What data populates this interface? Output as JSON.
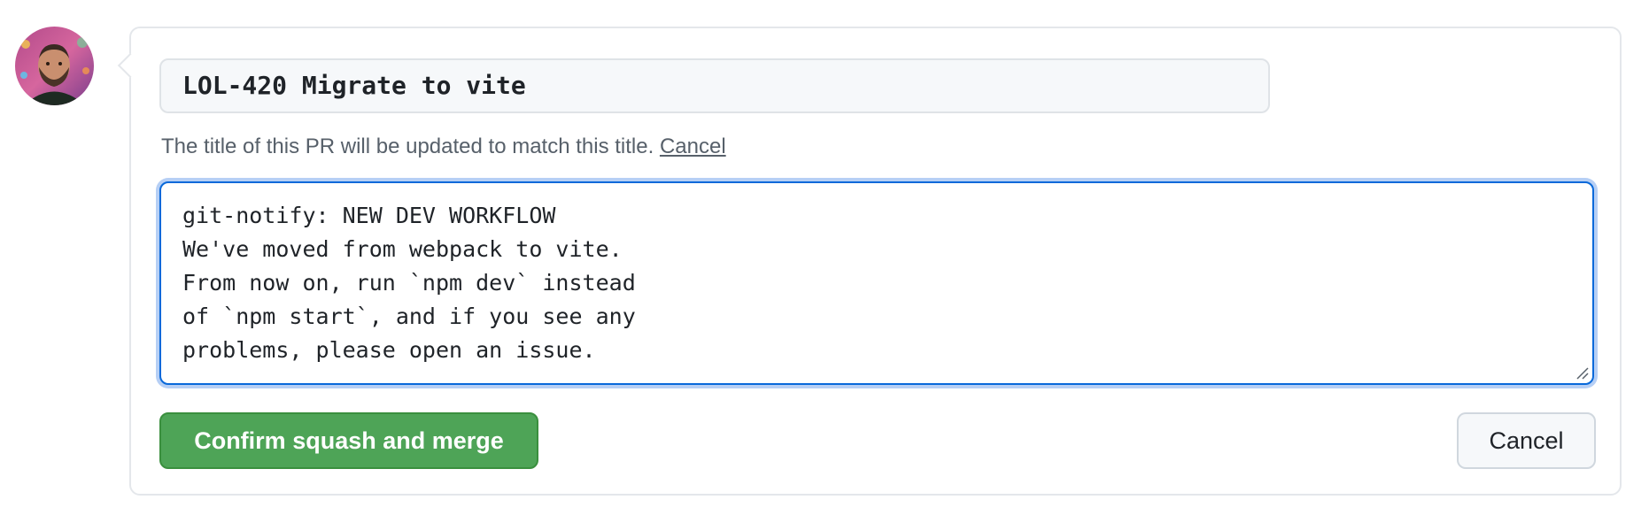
{
  "avatar": {
    "alt": "user avatar"
  },
  "title_field": {
    "value": "LOL-420 Migrate to vite"
  },
  "hint": {
    "text": "The title of this PR will be updated to match this title.",
    "cancel_link": "Cancel"
  },
  "message": {
    "value": "git-notify: NEW DEV WORKFLOW\nWe've moved from webpack to vite.\nFrom now on, run `npm dev` instead\nof `npm start`, and if you see any\nproblems, please open an issue."
  },
  "actions": {
    "confirm_label": "Confirm squash and merge",
    "cancel_label": "Cancel"
  },
  "colors": {
    "confirm_bg": "#4ea457",
    "focus_border": "#0969da",
    "focus_ring": "#b6cff5"
  }
}
